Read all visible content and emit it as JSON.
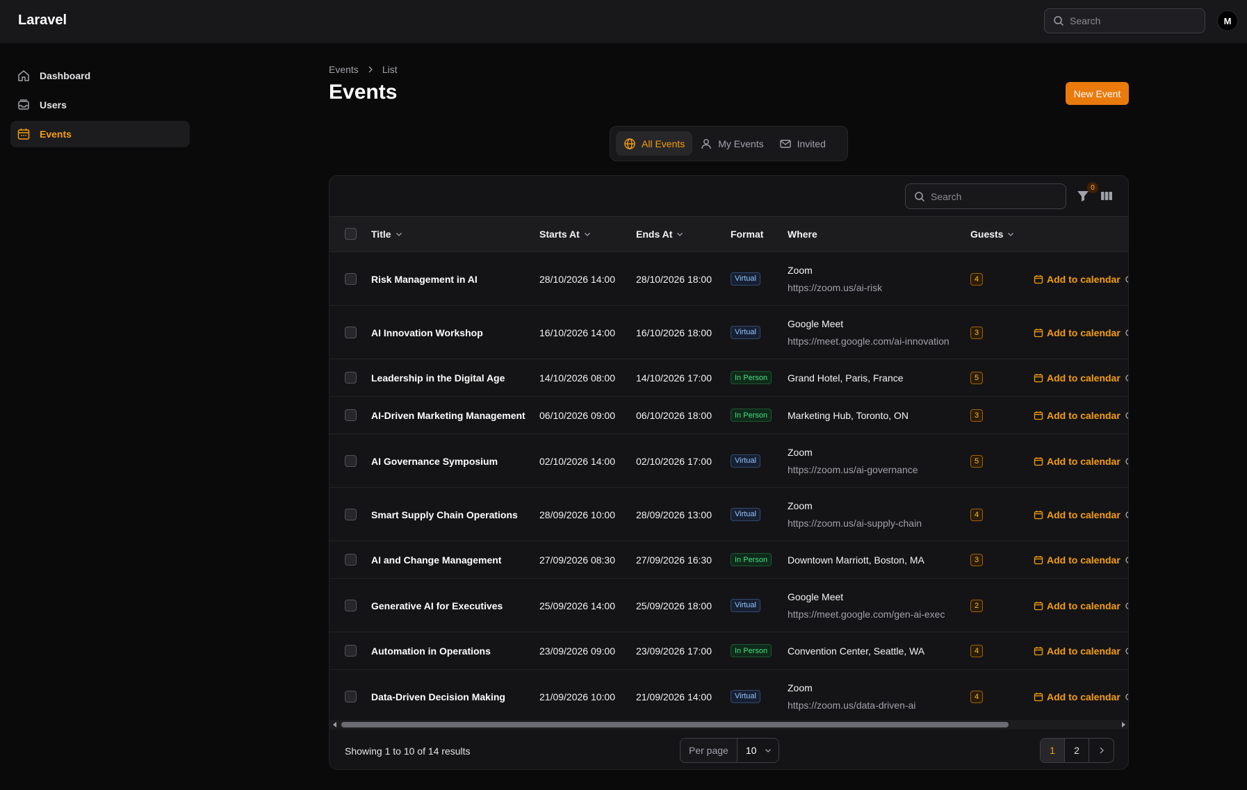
{
  "topbar": {
    "brand": "Laravel",
    "search_placeholder": "Search",
    "avatar_initial": "M"
  },
  "sidebar": {
    "items": [
      {
        "label": "Dashboard",
        "icon": "home-icon",
        "active": false
      },
      {
        "label": "Users",
        "icon": "inbox-icon",
        "active": false
      },
      {
        "label": "Events",
        "icon": "calendar-icon",
        "active": true
      }
    ]
  },
  "breadcrumb": {
    "items": [
      "Events",
      "List"
    ]
  },
  "page": {
    "title": "Events",
    "new_button": "New Event"
  },
  "tabs": [
    {
      "label": "All Events",
      "icon": "globe-icon",
      "active": true
    },
    {
      "label": "My Events",
      "icon": "user-icon",
      "active": false
    },
    {
      "label": "Invited",
      "icon": "envelope-icon",
      "active": false
    }
  ],
  "table": {
    "search_placeholder": "Search",
    "filter_count": "0",
    "columns": {
      "title": "Title",
      "starts_at": "Starts At",
      "ends_at": "Ends At",
      "format": "Format",
      "where": "Where",
      "guests": "Guests"
    },
    "action_label": "Add to calendar",
    "rows": [
      {
        "title": "Risk Management in AI",
        "starts": "28/10/2026 14:00",
        "ends": "28/10/2026 18:00",
        "format": "Virtual",
        "where": "Zoom",
        "where_sub": "https://zoom.us/ai-risk",
        "guests": "4"
      },
      {
        "title": "AI Innovation Workshop",
        "starts": "16/10/2026 14:00",
        "ends": "16/10/2026 18:00",
        "format": "Virtual",
        "where": "Google Meet",
        "where_sub": "https://meet.google.com/ai-innovation",
        "guests": "3"
      },
      {
        "title": "Leadership in the Digital Age",
        "starts": "14/10/2026 08:00",
        "ends": "14/10/2026 17:00",
        "format": "In Person",
        "where": "Grand Hotel, Paris, France",
        "where_sub": "",
        "guests": "5"
      },
      {
        "title": "AI-Driven Marketing Management",
        "starts": "06/10/2026 09:00",
        "ends": "06/10/2026 18:00",
        "format": "In Person",
        "where": "Marketing Hub, Toronto, ON",
        "where_sub": "",
        "guests": "3"
      },
      {
        "title": "AI Governance Symposium",
        "starts": "02/10/2026 14:00",
        "ends": "02/10/2026 17:00",
        "format": "Virtual",
        "where": "Zoom",
        "where_sub": "https://zoom.us/ai-governance",
        "guests": "5"
      },
      {
        "title": "Smart Supply Chain Operations",
        "starts": "28/09/2026 10:00",
        "ends": "28/09/2026 13:00",
        "format": "Virtual",
        "where": "Zoom",
        "where_sub": "https://zoom.us/ai-supply-chain",
        "guests": "4"
      },
      {
        "title": "AI and Change Management",
        "starts": "27/09/2026 08:30",
        "ends": "27/09/2026 16:30",
        "format": "In Person",
        "where": "Downtown Marriott, Boston, MA",
        "where_sub": "",
        "guests": "3"
      },
      {
        "title": "Generative AI for Executives",
        "starts": "25/09/2026 14:00",
        "ends": "25/09/2026 18:00",
        "format": "Virtual",
        "where": "Google Meet",
        "where_sub": "https://meet.google.com/gen-ai-exec",
        "guests": "2"
      },
      {
        "title": "Automation in Operations",
        "starts": "23/09/2026 09:00",
        "ends": "23/09/2026 17:00",
        "format": "In Person",
        "where": "Convention Center, Seattle, WA",
        "where_sub": "",
        "guests": "4"
      },
      {
        "title": "Data-Driven Decision Making",
        "starts": "21/09/2026 10:00",
        "ends": "21/09/2026 14:00",
        "format": "Virtual",
        "where": "Zoom",
        "where_sub": "https://zoom.us/data-driven-ai",
        "guests": "4"
      }
    ]
  },
  "footer": {
    "summary": "Showing 1 to 10 of 14 results",
    "per_page_label": "Per page",
    "per_page_value": "10",
    "pages": [
      "1",
      "2"
    ],
    "current_page": "1"
  },
  "colors": {
    "accent": "#f59e0b",
    "primary_button": "#ea7a0c"
  }
}
